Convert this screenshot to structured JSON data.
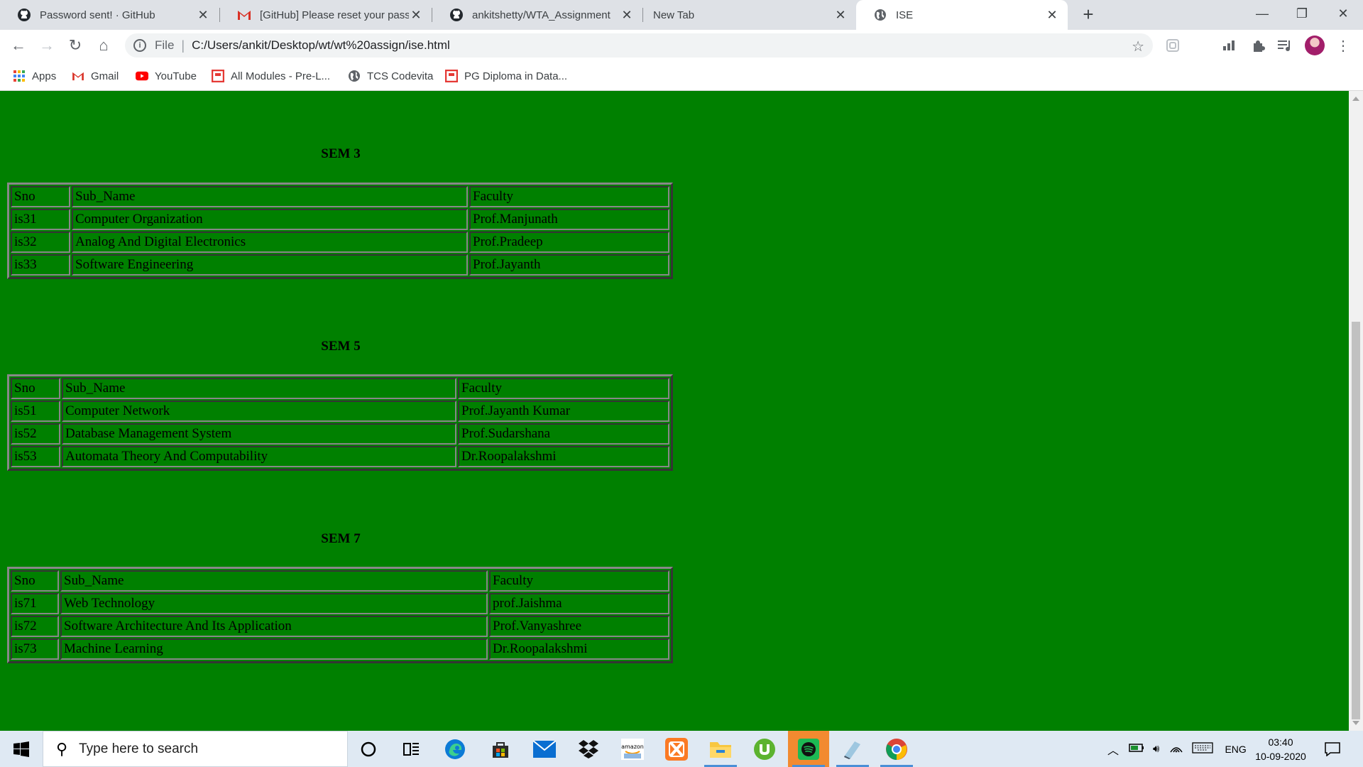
{
  "browser": {
    "tabs": [
      {
        "title": "Password sent! · GitHub",
        "icon": "github-icon"
      },
      {
        "title": "[GitHub] Please reset your passw",
        "icon": "gmail-icon"
      },
      {
        "title": "ankitshetty/WTA_Assignment",
        "icon": "github-icon"
      },
      {
        "title": "New Tab",
        "icon": ""
      },
      {
        "title": "ISE",
        "icon": "globe-icon",
        "active": true
      }
    ],
    "new_tab_symbol": "+",
    "address": {
      "scheme": "File",
      "url": "C:/Users/ankit/Desktop/wt/wt%20assign/ise.html"
    },
    "bookmarks": [
      {
        "label": "Apps",
        "icon": "apps-grid-icon"
      },
      {
        "label": "Gmail",
        "icon": "gmail-icon"
      },
      {
        "label": "YouTube",
        "icon": "youtube-icon"
      },
      {
        "label": "All Modules - Pre-L...",
        "icon": "module-icon"
      },
      {
        "label": "TCS Codevita",
        "icon": "globe-icon"
      },
      {
        "label": "PG Diploma in Data...",
        "icon": "module-icon"
      }
    ]
  },
  "page": {
    "background": "#008000",
    "semesters": [
      {
        "title": "SEM 3",
        "header": [
          "Sno",
          "Sub_Name",
          "Faculty"
        ],
        "rows": [
          [
            "is31",
            "Computer Organization",
            "Prof.Manjunath"
          ],
          [
            "is32",
            "Analog And Digital Electronics",
            "Prof.Pradeep"
          ],
          [
            "is33",
            "Software Engineering",
            "Prof.Jayanth"
          ]
        ]
      },
      {
        "title": "SEM 5",
        "header": [
          "Sno",
          "Sub_Name",
          "Faculty"
        ],
        "rows": [
          [
            "is51",
            "Computer Network",
            "Prof.Jayanth Kumar"
          ],
          [
            "is52",
            "Database Management System",
            "Prof.Sudarshana"
          ],
          [
            "is53",
            "Automata Theory And Computability",
            "Dr.Roopalakshmi"
          ]
        ]
      },
      {
        "title": "SEM 7",
        "header": [
          "Sno",
          "Sub_Name",
          "Faculty"
        ],
        "rows": [
          [
            "is71",
            "Web Technology",
            "prof.Jaishma"
          ],
          [
            "is72",
            "Software Architecture And Its Application",
            "Prof.Vanyashree"
          ],
          [
            "is73",
            "Machine Learning",
            "Dr.Roopalakshmi"
          ]
        ]
      }
    ]
  },
  "taskbar": {
    "search_placeholder": "Type here to search",
    "apps": [
      "cortana-icon",
      "task-view-icon",
      "edge-icon",
      "store-icon",
      "mail-icon",
      "dropbox-icon",
      "amazon-icon",
      "xampp-icon",
      "file-explorer-icon",
      "utorrent-icon",
      "spotify-icon",
      "app-icon",
      "chrome-icon"
    ],
    "tray": {
      "language": "ENG",
      "time": "03:40",
      "date": "10-09-2020"
    }
  }
}
